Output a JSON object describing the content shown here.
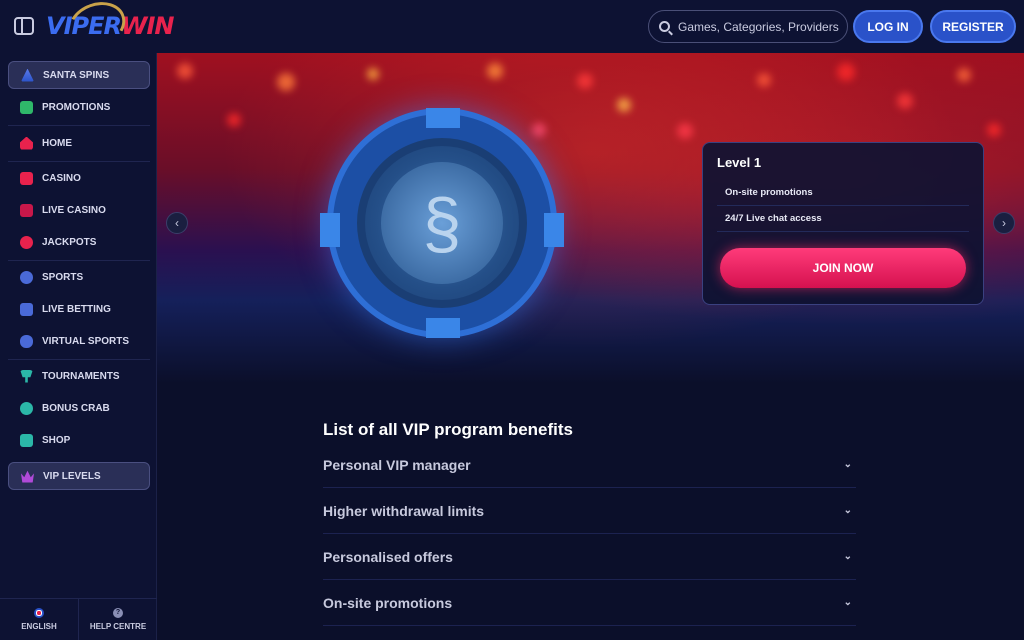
{
  "header": {
    "logo_text_a": "VIPER",
    "logo_text_b": "WIN",
    "search_placeholder": "Games, Categories, Providers",
    "login_label": "LOG IN",
    "register_label": "REGISTER"
  },
  "sidebar": {
    "items": [
      {
        "label": "SANTA SPINS",
        "icon": "tree-icon"
      },
      {
        "label": "PROMOTIONS",
        "icon": "gift-icon"
      },
      {
        "label": "HOME",
        "icon": "home-icon"
      },
      {
        "label": "CASINO",
        "icon": "slot-machine-icon"
      },
      {
        "label": "LIVE CASINO",
        "icon": "cards-icon"
      },
      {
        "label": "JACKPOTS",
        "icon": "clover-icon"
      },
      {
        "label": "SPORTS",
        "icon": "ball-icon"
      },
      {
        "label": "LIVE BETTING",
        "icon": "scoreboard-icon"
      },
      {
        "label": "VIRTUAL SPORTS",
        "icon": "gamepad-icon"
      },
      {
        "label": "TOURNAMENTS",
        "icon": "trophy-icon"
      },
      {
        "label": "BONUS CRAB",
        "icon": "crab-icon"
      },
      {
        "label": "SHOP",
        "icon": "shopping-bag-icon"
      },
      {
        "label": "VIP LEVELS",
        "icon": "crown-icon"
      }
    ],
    "footer": {
      "language": "ENGLISH",
      "help": "HELP CENTRE"
    }
  },
  "hero": {
    "level_title": "Level 1",
    "level_rows": [
      "On-site promotions",
      "24/7 Live chat access"
    ],
    "join_label": "JOIN NOW"
  },
  "benefits": {
    "title": "List of all VIP program benefits",
    "items": [
      "Personal VIP manager",
      "Higher withdrawal limits",
      "Personalised offers",
      "On-site promotions"
    ]
  },
  "colors": {
    "accent_blue": "#2a52c9",
    "accent_pink": "#e8224d",
    "background": "#0b0f2a"
  }
}
